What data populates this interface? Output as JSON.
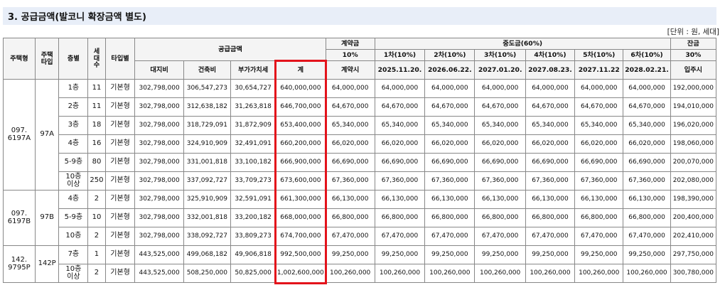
{
  "title": "3. 공급금액(발코니 확장금액 별도)",
  "unit_note": "[단위 : 원, 세대]",
  "headers": {
    "housing_type": "주택형",
    "housing_tag_line1": "주택",
    "housing_tag_line2": "타입",
    "floor": "층별",
    "households_l1": "세",
    "households_l2": "대",
    "households_l3": "수",
    "type_by": "타입별",
    "supply_price": "공급금액",
    "land": "대지비",
    "building": "건축비",
    "vat": "부가가치세",
    "total": "계",
    "contract_group": "계약금",
    "contract_pct": "10%",
    "contract_when": "계약시",
    "middle_group": "중도금(60%)",
    "middle": [
      {
        "label": "1차(10%)",
        "date": "2025.11.20."
      },
      {
        "label": "2차(10%)",
        "date": "2026.06.22."
      },
      {
        "label": "3차(10%)",
        "date": "2027.01.20."
      },
      {
        "label": "4차(10%)",
        "date": "2027.08.23."
      },
      {
        "label": "5차(10%)",
        "date": "2027.11.22"
      },
      {
        "label": "6차(10%)",
        "date": "2028.02.21."
      }
    ],
    "balance_group": "잔금",
    "balance_pct": "30%",
    "balance_when": "입주시"
  },
  "groups": [
    {
      "housing_type": [
        "097.",
        "6197A"
      ],
      "type": "97A",
      "rows": [
        {
          "floor": [
            "1층"
          ],
          "households": "11",
          "kind": "기본형",
          "land": "302,798,000",
          "building": "306,547,273",
          "vat": "30,654,727",
          "total": "640,000,000",
          "contract": "64,000,000",
          "middle": [
            "64,000,000",
            "64,000,000",
            "64,000,000",
            "64,000,000",
            "64,000,000",
            "64,000,000"
          ],
          "balance": "192,000,000"
        },
        {
          "floor": [
            "2층"
          ],
          "households": "11",
          "kind": "기본형",
          "land": "302,798,000",
          "building": "312,638,182",
          "vat": "31,263,818",
          "total": "646,700,000",
          "contract": "64,670,000",
          "middle": [
            "64,670,000",
            "64,670,000",
            "64,670,000",
            "64,670,000",
            "64,670,000",
            "64,670,000"
          ],
          "balance": "194,010,000"
        },
        {
          "floor": [
            "3층"
          ],
          "households": "18",
          "kind": "기본형",
          "land": "302,798,000",
          "building": "318,729,091",
          "vat": "31,872,909",
          "total": "653,400,000",
          "contract": "65,340,000",
          "middle": [
            "65,340,000",
            "65,340,000",
            "65,340,000",
            "65,340,000",
            "65,340,000",
            "65,340,000"
          ],
          "balance": "196,020,000"
        },
        {
          "floor": [
            "4층"
          ],
          "households": "16",
          "kind": "기본형",
          "land": "302,798,000",
          "building": "324,910,909",
          "vat": "32,491,091",
          "total": "660,200,000",
          "contract": "66,020,000",
          "middle": [
            "66,020,000",
            "66,020,000",
            "66,020,000",
            "66,020,000",
            "66,020,000",
            "66,020,000"
          ],
          "balance": "198,060,000"
        },
        {
          "floor": [
            "5-9층"
          ],
          "households": "80",
          "kind": "기본형",
          "land": "302,798,000",
          "building": "331,001,818",
          "vat": "33,100,182",
          "total": "666,900,000",
          "contract": "66,690,000",
          "middle": [
            "66,690,000",
            "66,690,000",
            "66,690,000",
            "66,690,000",
            "66,690,000",
            "66,690,000"
          ],
          "balance": "200,070,000"
        },
        {
          "floor": [
            "10층",
            "이상"
          ],
          "households": "250",
          "kind": "기본형",
          "land": "302,798,000",
          "building": "337,092,727",
          "vat": "33,709,273",
          "total": "673,600,000",
          "contract": "67,360,000",
          "middle": [
            "67,360,000",
            "67,360,000",
            "67,360,000",
            "67,360,000",
            "67,360,000",
            "67,360,000"
          ],
          "balance": "202,080,000"
        }
      ]
    },
    {
      "housing_type": [
        "097.",
        "6197B"
      ],
      "type": "97B",
      "rows": [
        {
          "floor": [
            "4층"
          ],
          "households": "2",
          "kind": "기본형",
          "land": "302,798,000",
          "building": "325,910,909",
          "vat": "32,591,091",
          "total": "661,300,000",
          "contract": "66,130,000",
          "middle": [
            "66,130,000",
            "66,130,000",
            "66,130,000",
            "66,130,000",
            "66,130,000",
            "66,130,000"
          ],
          "balance": "198,390,000"
        },
        {
          "floor": [
            "5-9층"
          ],
          "households": "10",
          "kind": "기본형",
          "land": "302,798,000",
          "building": "332,001,818",
          "vat": "33,200,182",
          "total": "668,000,000",
          "contract": "66,800,000",
          "middle": [
            "66,800,000",
            "66,800,000",
            "66,800,000",
            "66,800,000",
            "66,800,000",
            "66,800,000"
          ],
          "balance": "200,400,000"
        },
        {
          "floor": [
            "10층"
          ],
          "households": "2",
          "kind": "기본형",
          "land": "302,798,000",
          "building": "338,092,727",
          "vat": "33,809,273",
          "total": "674,700,000",
          "contract": "67,470,000",
          "middle": [
            "67,470,000",
            "67,470,000",
            "67,470,000",
            "67,470,000",
            "67,470,000",
            "67,470,000"
          ],
          "balance": "202,410,000"
        }
      ]
    },
    {
      "housing_type": [
        "142.",
        "9795P"
      ],
      "type": "142P",
      "rows": [
        {
          "floor": [
            "7층"
          ],
          "households": "1",
          "kind": "기본형",
          "land": "443,525,000",
          "building": "499,068,182",
          "vat": "49,906,818",
          "total": "992,500,000",
          "contract": "99,250,000",
          "middle": [
            "99,250,000",
            "99,250,000",
            "99,250,000",
            "99,250,000",
            "99,250,000",
            "99,250,000"
          ],
          "balance": "297,750,000"
        },
        {
          "floor": [
            "10층",
            "이상"
          ],
          "households": "2",
          "kind": "기본형",
          "land": "443,525,000",
          "building": "508,250,000",
          "vat": "50,825,000",
          "total": "1,002,600,000",
          "contract": "100,260,000",
          "middle": [
            "100,260,000",
            "100,260,000",
            "100,260,000",
            "100,260,000",
            "100,260,000",
            "100,260,000"
          ],
          "balance": "300,780,000"
        }
      ]
    }
  ],
  "highlight_color": "#e3131b"
}
